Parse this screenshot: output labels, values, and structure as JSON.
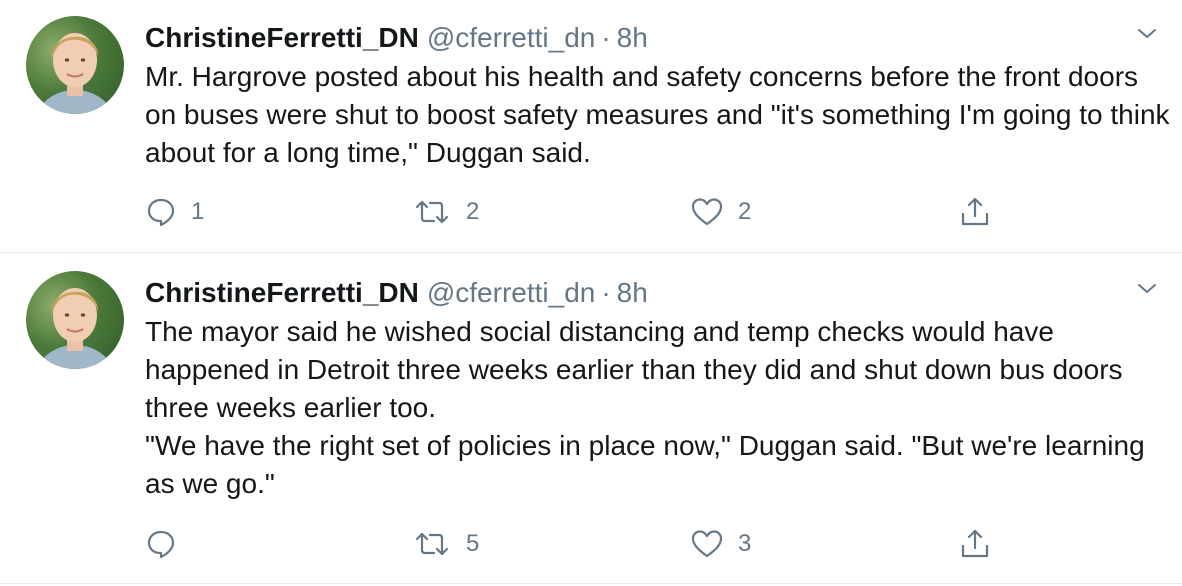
{
  "tweets": [
    {
      "display_name": "ChristineFerretti_DN",
      "handle": "@cferretti_dn",
      "separator": "·",
      "time": "8h",
      "text": "Mr. Hargrove posted about his health and safety concerns before the front doors on buses were shut to boost safety measures and \"it's something I'm going to think about for a long time,\" Duggan said.",
      "replies": "1",
      "retweets": "2",
      "likes": "2"
    },
    {
      "display_name": "ChristineFerretti_DN",
      "handle": "@cferretti_dn",
      "separator": "·",
      "time": "8h",
      "text": "The mayor said he wished social distancing and temp checks would have happened in Detroit three weeks earlier than they did and shut down bus doors three weeks earlier too.\n\"We have the right set of policies in place now,\" Duggan said. \"But we're learning as we go.\"",
      "replies": "",
      "retweets": "5",
      "likes": "3"
    }
  ],
  "icons": {
    "reply": "reply-icon",
    "retweet": "retweet-icon",
    "like": "heart-icon",
    "share": "share-icon",
    "menu": "chevron-down-icon"
  },
  "colors": {
    "text": "#14171a",
    "secondary": "#657786",
    "divider": "#e6ecf0"
  }
}
